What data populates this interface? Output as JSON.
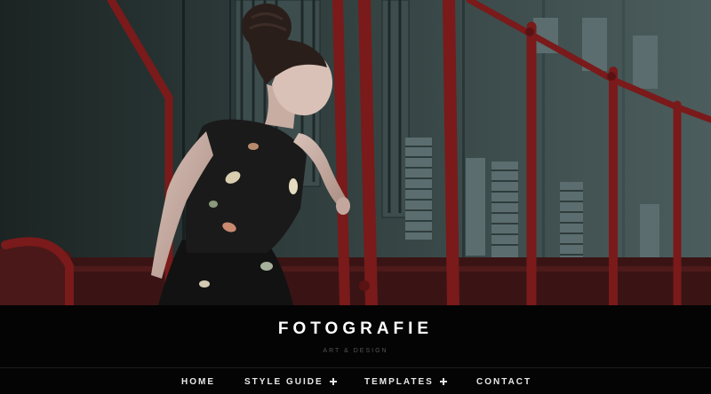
{
  "hero": {
    "image_name": "woman-in-floral-dress-on-train-steps-photo"
  },
  "site": {
    "title": "FOTOGRAFIE",
    "tagline": "ART & DESIGN"
  },
  "nav": {
    "items": [
      {
        "label": "HOME",
        "has_submenu": false
      },
      {
        "label": "STYLE GUIDE",
        "has_submenu": true
      },
      {
        "label": "TEMPLATES",
        "has_submenu": true
      },
      {
        "label": "CONTACT",
        "has_submenu": false
      }
    ],
    "submenu_icon": "plus-icon"
  },
  "colors": {
    "header_background": "#040404",
    "title_text": "#ffffff",
    "tagline_text": "#555555",
    "nav_text": "#e8e8e8",
    "railing_red": "#7a1a1a"
  }
}
